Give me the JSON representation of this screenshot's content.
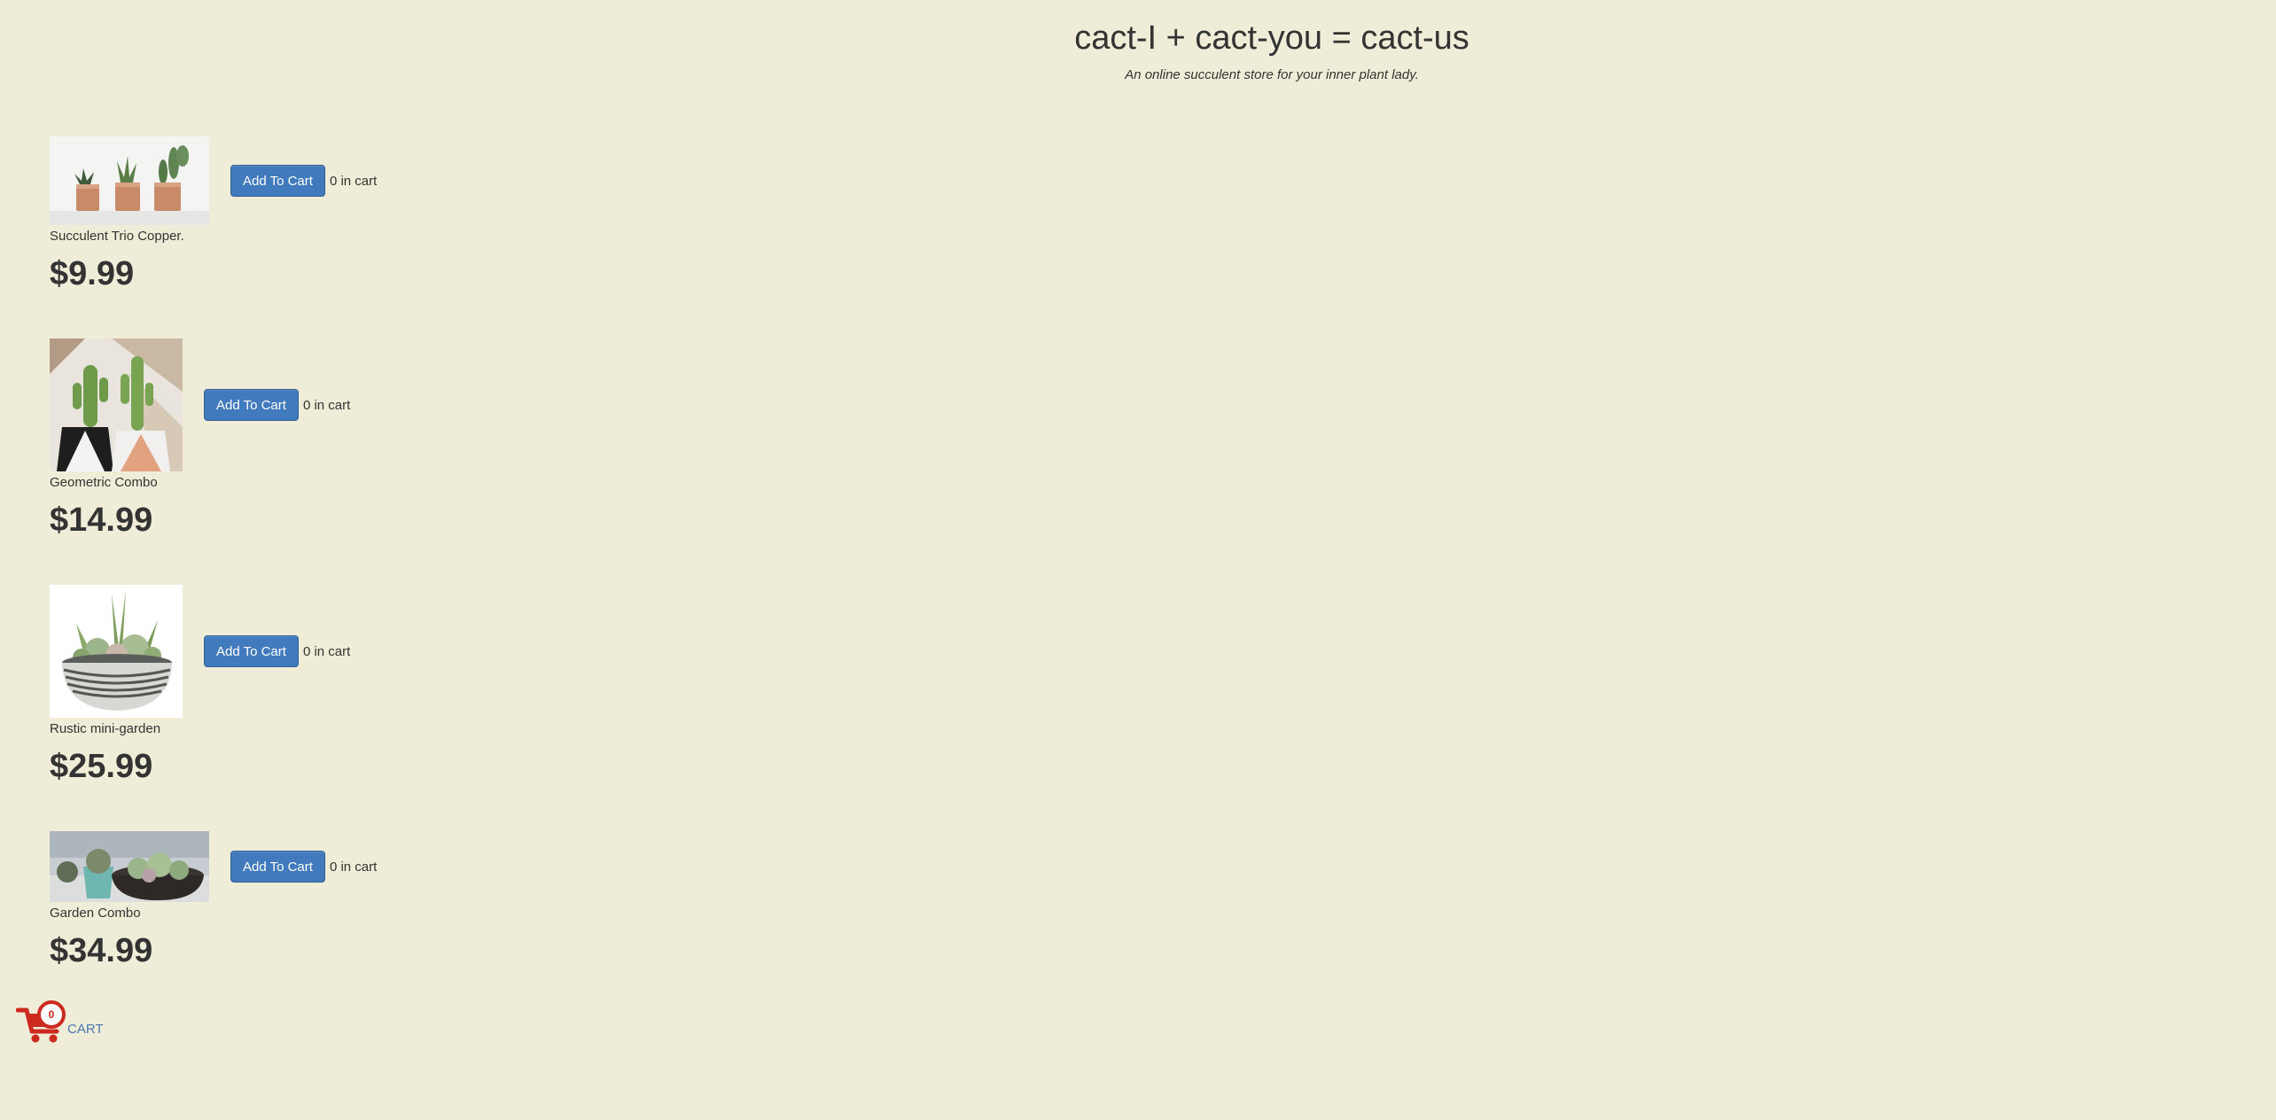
{
  "header": {
    "title": "cact-I + cact-you = cact-us",
    "subtitle": "An online succulent store for your inner plant lady."
  },
  "products": [
    {
      "name": "Succulent Trio Copper.",
      "price": "$9.99",
      "button_label": "Add To Cart",
      "cart_status": "0 in cart"
    },
    {
      "name": "Geometric Combo",
      "price": "$14.99",
      "button_label": "Add To Cart",
      "cart_status": "0 in cart"
    },
    {
      "name": "Rustic mini-garden",
      "price": "$25.99",
      "button_label": "Add To Cart",
      "cart_status": "0 in cart"
    },
    {
      "name": "Garden Combo",
      "price": "$34.99",
      "button_label": "Add To Cart",
      "cart_status": "0 in cart"
    }
  ],
  "cart": {
    "count": "0",
    "label": "CART",
    "icon": "shopping-cart-icon",
    "color": "#cc2a1f"
  },
  "colors": {
    "background": "#efedd8",
    "button": "#427bbd",
    "link": "#4a77b0"
  }
}
